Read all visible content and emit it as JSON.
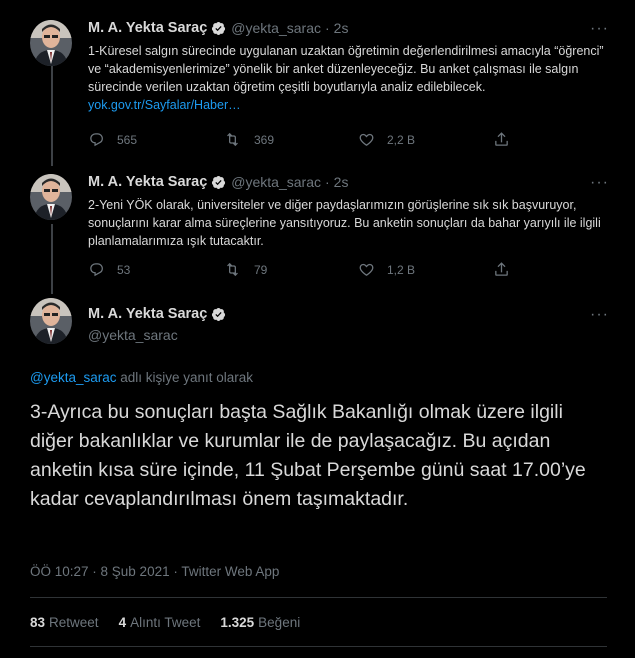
{
  "colors": {
    "background": "#000000",
    "text": "#d9d9d9",
    "muted": "#6e767d",
    "link": "#1d9bf0",
    "verified": "#d9d9d9"
  },
  "tweets": [
    {
      "name": "M. A. Yekta Saraç",
      "handle": "@yekta_sarac",
      "time": "2s",
      "text": "1-Küresel salgın sürecinde uygulanan uzaktan öğretimin değerlendirilmesi amacıyla “öğrenci” ve “akademisyenlerimize” yönelik bir anket düzenleyeceğiz. Bu anket çalışması ile salgın sürecinde verilen uzaktan öğretim çeşitli boyutlarıyla analiz edilebilecek.",
      "link_text": "yok.gov.tr/Sayfalar/Haber…",
      "replies": "565",
      "retweets": "369",
      "likes": "2,2 B"
    },
    {
      "name": "M. A. Yekta Saraç",
      "handle": "@yekta_sarac",
      "time": "2s",
      "text": "2-Yeni YÖK olarak, üniversiteler ve diğer paydaşlarımızın görüşlerine sık sık başvuruyor, sonuçlarını karar alma süreçlerine yansıtıyoruz. Bu anketin sonuçları da bahar yarıyılı ile ilgili planlamalarımıza ışık tutacaktır.",
      "replies": "53",
      "retweets": "79",
      "likes": "1,2 B"
    }
  ],
  "main": {
    "name": "M. A. Yekta Saraç",
    "handle": "@yekta_sarac",
    "reply_to_handle": "@yekta_sarac",
    "reply_to_suffix": " adlı kişiye yanıt olarak",
    "text": "3-Ayrıca bu sonuçları başta Sağlık Bakanlığı olmak üzere ilgili diğer bakanlıklar ve kurumlar ile de paylaşacağız. Bu açıdan anketin kısa süre içinde, 11 Şubat Perşembe günü saat 17.00’ye kadar cevaplandırılması önem taşımaktadır.",
    "timestamp": "ÖÖ 10:27 · 8 Şub 2021 · Twitter Web App",
    "retweet_count": "83",
    "retweet_label": "Retweet",
    "quote_count": "4",
    "quote_label": "Alıntı Tweet",
    "like_count": "1.325",
    "like_label": "Beğeni"
  },
  "icons": {
    "more": "more-horizontal-icon",
    "reply": "reply-icon",
    "retweet": "retweet-icon",
    "like": "heart-icon",
    "share": "share-icon",
    "verified": "verified-badge-icon"
  }
}
